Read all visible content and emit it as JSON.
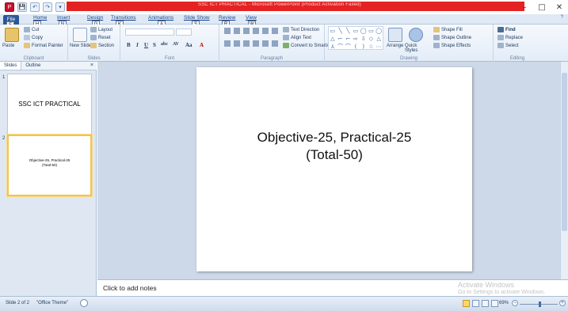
{
  "titlebar": {
    "title": "SSC ICT PRACTICAL - Microsoft PowerPoint (Product Activation Failed)",
    "controls": {
      "minimize": "–",
      "maximize": "□",
      "close": "✕"
    },
    "qat": [
      "P",
      "💾",
      "↶",
      "↷",
      "▾"
    ]
  },
  "tabs": {
    "file": "File",
    "items": [
      "Home",
      "Insert",
      "Design",
      "Transitions",
      "Animations",
      "Slide Show",
      "Review",
      "View"
    ],
    "keytips": [
      "F",
      "H",
      "N",
      "G",
      "K",
      "A",
      "S",
      "R",
      "W"
    ]
  },
  "ribbon": {
    "clipboard": {
      "label": "Clipboard",
      "paste": "Paste",
      "cut": "Cut",
      "copy": "Copy",
      "format_painter": "Format Painter"
    },
    "slides": {
      "label": "Slides",
      "new_slide": "New Slide",
      "layout": "Layout",
      "reset": "Reset",
      "section": "Section"
    },
    "font": {
      "label": "Font",
      "bold": "B",
      "italic": "I",
      "underline": "U",
      "strike": "S",
      "shadow": "abc",
      "spacing": "AV",
      "case": "Aa",
      "color": "A"
    },
    "paragraph": {
      "label": "Paragraph",
      "text_direction": "Text Direction",
      "align_text": "Align Text",
      "convert_smartart": "Convert to SmartArt"
    },
    "drawing": {
      "label": "Drawing",
      "arrange": "Arrange",
      "quick_styles": "Quick Styles",
      "shape_fill": "Shape Fill",
      "shape_outline": "Shape Outline",
      "shape_effects": "Shape Effects"
    },
    "editing": {
      "label": "Editing",
      "find": "Find",
      "replace": "Replace",
      "select": "Select"
    },
    "shape_glyphs": [
      "▭",
      "╲",
      "╲",
      "▭",
      "◯",
      "▭",
      "◯",
      "△",
      "⌐",
      "⌐",
      "⇨",
      "⇩",
      "◇",
      "△",
      "⅄",
      "⌒",
      "⌒",
      "(",
      ")",
      "☆",
      "⋯"
    ]
  },
  "left_pane": {
    "tabs": [
      "Slides",
      "Outline"
    ],
    "close": "×",
    "slides": [
      {
        "number": "1",
        "text": "SSC ICT PRACTICAL"
      },
      {
        "number": "2",
        "text": "Objective-25, Practical-25\n(Total-50)"
      }
    ]
  },
  "slide": {
    "line1": "Objective-25, Practical-25",
    "line2": "(Total-50)"
  },
  "notes": {
    "placeholder": "Click to add notes",
    "watermark_line1": "Activate Windows",
    "watermark_line2": "Go to Settings to activate Windows."
  },
  "statusbar": {
    "slide_info": "Slide 2 of 2",
    "theme": "\"Office Theme\"",
    "zoom": "69%",
    "zoom_out": "−",
    "zoom_in": "+"
  }
}
